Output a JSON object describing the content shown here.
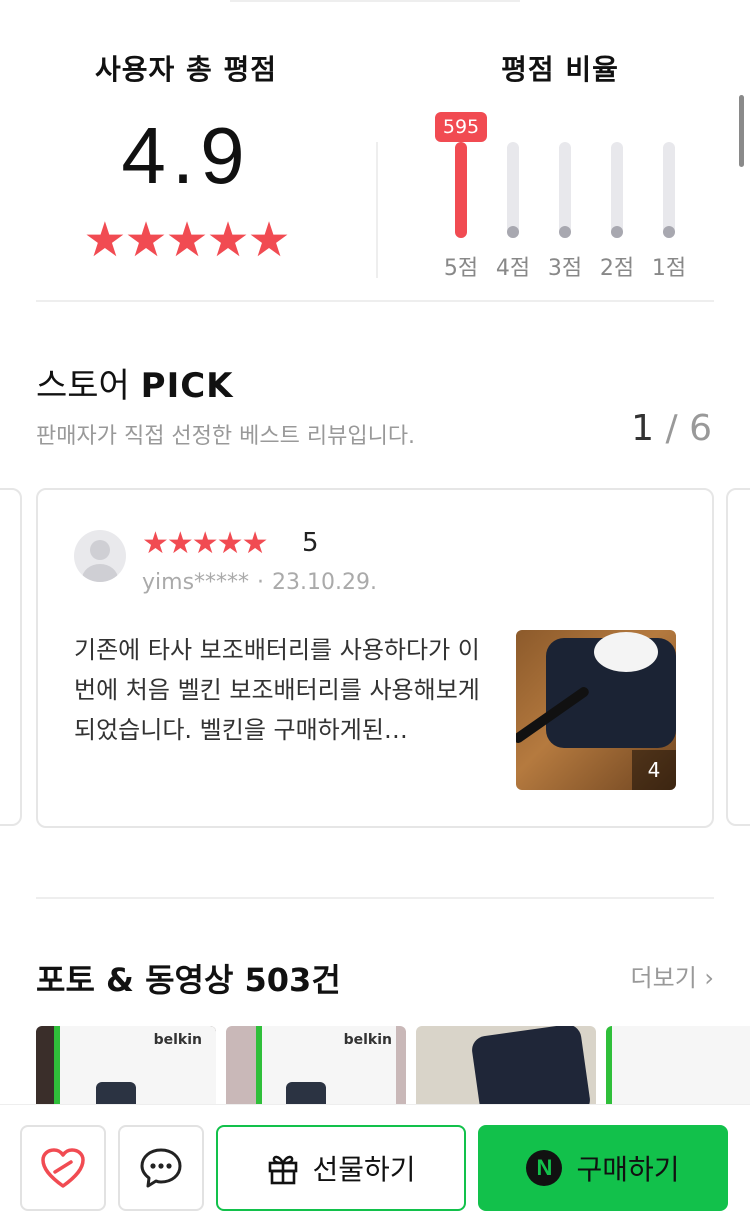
{
  "summary": {
    "title": "사용자 총 평점",
    "avg_score": "4.9",
    "stars": "★★★★★",
    "ratio_title": "평점 비율",
    "bars": [
      {
        "label": "5점",
        "fraction": 1.0,
        "count": "595"
      },
      {
        "label": "4점",
        "fraction": 0.0
      },
      {
        "label": "3점",
        "fraction": 0.0
      },
      {
        "label": "2점",
        "fraction": 0.0
      },
      {
        "label": "1점",
        "fraction": 0.0
      }
    ],
    "accent_color": "#f14b52"
  },
  "store_pick": {
    "title_prefix": "스토어",
    "title_bold": "PICK",
    "subtitle": "판매자가 직접 선정한 베스트 리뷰입니다.",
    "pager": {
      "current": "1",
      "sep": "/",
      "total": "6"
    },
    "review": {
      "stars": "★★★★★",
      "score": "5",
      "user": "yims*****",
      "dot": "·",
      "date": "23.10.29.",
      "text": "기존에 타사 보조배터리를 사용하다가 이번에 처음 벨킨 보조배터리를 사용해보게 되었습니다. 벨킨을 구매하게된…",
      "photo_count": "4"
    }
  },
  "photos": {
    "title": "포토 & 동영상 503건",
    "more": "더보기 ›",
    "items": [
      {
        "brand": "belkin"
      },
      {
        "brand": "belkin"
      },
      {
        "brand": ""
      },
      {
        "brand": ""
      }
    ]
  },
  "bottom_bar": {
    "gift_label": "선물하기",
    "buy_label": "구매하기",
    "buy_badge": "N",
    "brand_color": "#12c14b"
  }
}
